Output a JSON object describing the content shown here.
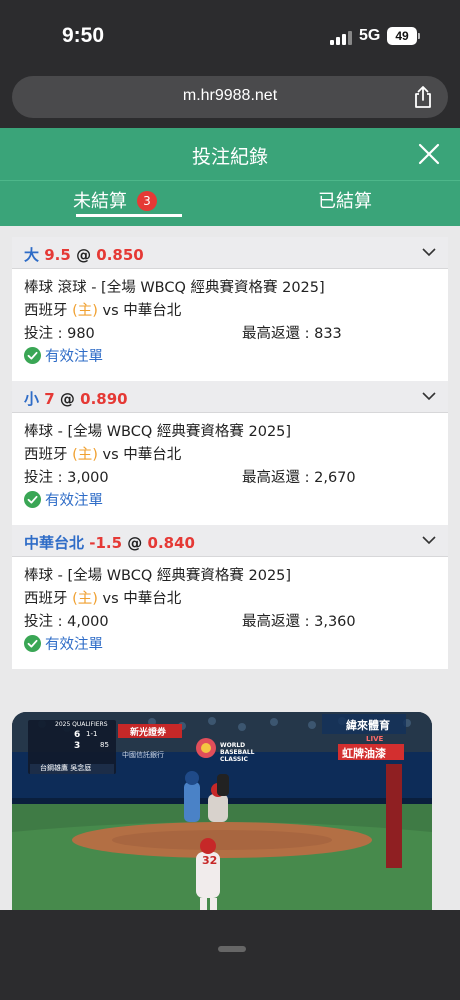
{
  "status": {
    "time": "9:50",
    "network": "5G",
    "battery": "49"
  },
  "browser": {
    "url": "m.hr9988.net"
  },
  "sheet": {
    "title": "投注紀錄",
    "tabs": {
      "unsettled": "未結算",
      "unsettled_count": "3",
      "settled": "已結算"
    }
  },
  "bets": [
    {
      "selection": "大",
      "line": "9.5",
      "at": "@",
      "odds": "0.850",
      "market": "棒球 滾球 - [全場 WBCQ 經典賽資格賽 2025]",
      "home_team": "西班牙",
      "home_tag": "(主)",
      "vs": "vs",
      "away_team": "中華台北",
      "stake_label": "投注 : 980",
      "return_label": "最高返還 : 833",
      "status": "有效注單"
    },
    {
      "selection": "小",
      "line": "7",
      "at": "@",
      "odds": "0.890",
      "market": "棒球 - [全場 WBCQ 經典賽資格賽 2025]",
      "home_team": "西班牙",
      "home_tag": "(主)",
      "vs": "vs",
      "away_team": "中華台北",
      "stake_label": "投注 : 3,000",
      "return_label": "最高返還 : 2,670",
      "status": "有效注單"
    },
    {
      "selection": "中華台北",
      "line": "-1.5",
      "at": "@",
      "odds": "0.840",
      "market": "棒球 - [全場 WBCQ 經典賽資格賽 2025]",
      "home_team": "西班牙",
      "home_tag": "(主)",
      "vs": "vs",
      "away_team": "中華台北",
      "stake_label": "投注 : 4,000",
      "return_label": "最高返還 : 3,360",
      "status": "有效注單"
    }
  ],
  "video": {
    "scorebug_title": "2025 QUALIFIERS",
    "score_away": "6",
    "score_home": "3",
    "count": "1-1",
    "pitch_speed": "85",
    "batter_name": "台鋼雄鷹 吳念庭",
    "broadcaster": "緯來體育",
    "sponsor": "新光證券",
    "wbc_logo_text": "WORLD BASEBALL CLASSIC",
    "ad_text": "虹牌油漆",
    "jersey_number": "32",
    "live_label": "LIVE",
    "bank_ad": "中國信託銀行"
  },
  "colors": {
    "primary": "#3aa479",
    "accent_red": "#e53935",
    "accent_blue": "#2e6cc7",
    "home_orange": "#f0a030"
  }
}
